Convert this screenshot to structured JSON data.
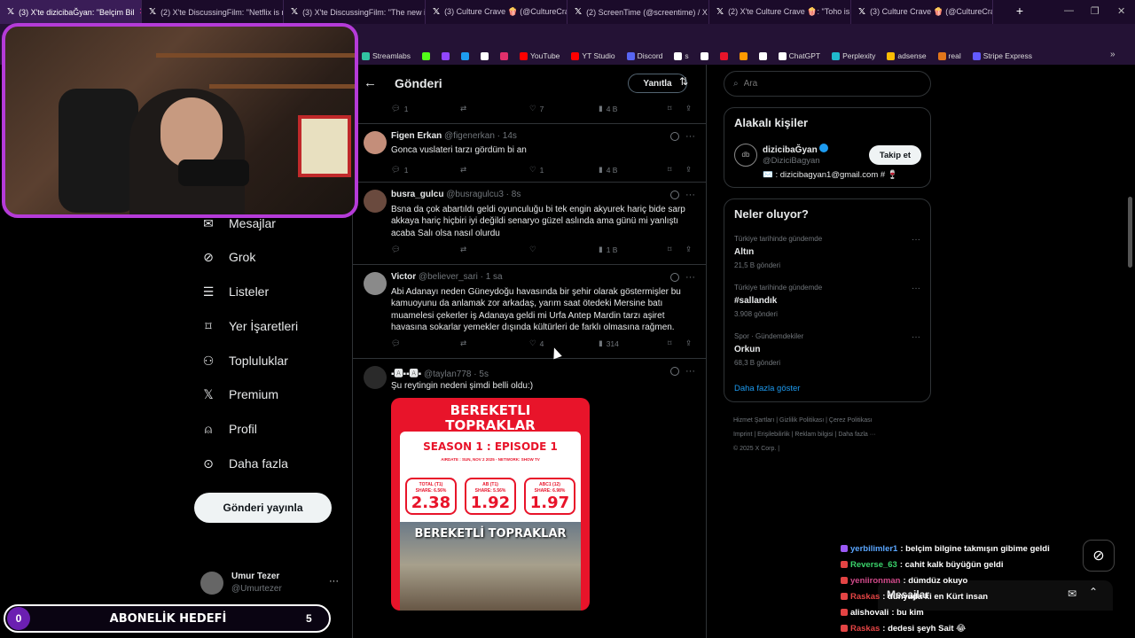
{
  "browser": {
    "tabs": [
      {
        "label": "(3) X'te dizicibaĞyan: \"Belçim Bil",
        "active": true
      },
      {
        "label": "(2) X'te DiscussingFilm: \"Netflix is no",
        "active": false
      },
      {
        "label": "(3) X'te DiscussingFilm: \"The new ini",
        "active": false
      },
      {
        "label": "(3) Culture Crave 🍿 (@CultureCrav",
        "active": false
      },
      {
        "label": "(2) ScreenTime (@screentime) / X",
        "active": false
      },
      {
        "label": "(2) X'te Culture Crave 🍿: \"Toho is m",
        "active": false
      },
      {
        "label": "(3) Culture Crave 🍿 (@CultureCrav",
        "active": false
      }
    ],
    "bookmarks": [
      {
        "label": "Streamlabs",
        "color": "#31c3a2"
      },
      {
        "label": "",
        "color": "#53fc18"
      },
      {
        "label": "",
        "color": "#9146ff"
      },
      {
        "label": "",
        "color": "#1d9bf0"
      },
      {
        "label": "",
        "color": "#ffffff"
      },
      {
        "label": "",
        "color": "#e1306c"
      },
      {
        "label": "YouTube",
        "color": "#ff0000"
      },
      {
        "label": "YT Studio",
        "color": "#ff0000"
      },
      {
        "label": "Discord",
        "color": "#5865f2"
      },
      {
        "label": "s",
        "color": "#ffffff"
      },
      {
        "label": "",
        "color": "#ffffff"
      },
      {
        "label": "",
        "color": "#e8142a"
      },
      {
        "label": "",
        "color": "#ff9900"
      },
      {
        "label": "",
        "color": "#ffffff"
      },
      {
        "label": "ChatGPT",
        "color": "#ffffff"
      },
      {
        "label": "Perplexity",
        "color": "#20b8cd"
      },
      {
        "label": "adsense",
        "color": "#fbbc04"
      },
      {
        "label": "real",
        "color": "#e2761b"
      },
      {
        "label": "Stripe Express",
        "color": "#635bff"
      }
    ]
  },
  "nav": {
    "items": [
      {
        "label": "Mesajlar",
        "icon": "mail-icon"
      },
      {
        "label": "Grok",
        "icon": "grok-icon"
      },
      {
        "label": "Listeler",
        "icon": "list-icon"
      },
      {
        "label": "Yer İşaretleri",
        "icon": "bookmark-icon"
      },
      {
        "label": "Topluluklar",
        "icon": "communities-icon"
      },
      {
        "label": "Premium",
        "icon": "x-logo-icon"
      },
      {
        "label": "Profil",
        "icon": "profile-icon"
      },
      {
        "label": "Daha fazla",
        "icon": "more-circle-icon"
      }
    ],
    "post_button": "Gönderi yayınla",
    "account": {
      "name": "Umur Tezer",
      "handle": "@Umurtezer"
    }
  },
  "overlay": {
    "sub_goal": {
      "label": "ABONELİK HEDEFİ",
      "current": "0",
      "target": "5"
    }
  },
  "feed": {
    "title": "Gönderi",
    "reply_button": "Yanıtla",
    "top_actions": {
      "replies": "1",
      "retweets": "",
      "likes": "7",
      "views": "4 B"
    },
    "tweets": [
      {
        "name": "Figen Erkan",
        "handle": "@figenerkan",
        "time": "14s",
        "text": "Gonca vuslateri  tarzı gördüm bi an",
        "replies": "1",
        "retweets": "",
        "likes": "1",
        "views": "4 B"
      },
      {
        "name": "busra_gulcu",
        "handle": "@busragulcu3",
        "time": "8s",
        "text": "Bsna da çok abartıldı geldi oyunculuğu bi tek engin akyurek hariç bide sarp akkaya hariç hiçbiri iyi değildi senaryo güzel aslında ama günü mi yanlıştı acaba Salı olsa nasıl olurdu",
        "replies": "",
        "retweets": "",
        "likes": "",
        "views": "1 B"
      },
      {
        "name": "Victor",
        "handle": "@believer_sari",
        "time": "1 sa",
        "text": "Abi Adanayı neden Güneydoğu havasında bir şehir olarak göstermişler bu kamuoyunu da anlamak zor arkadaş, yarım saat ötedeki Mersine batı muamelesi çekerler iş Adanaya geldi mi Urfa Antep Mardin tarzı aşiret havasına sokarlar yemekler dışında kültürleri de farklı olmasına rağmen.",
        "replies": "",
        "retweets": "",
        "likes": "4",
        "views": "314"
      },
      {
        "name": "▪🅰▪▪🅰▪",
        "handle": "@taylan778",
        "time": "5s",
        "text": "Şu reytingin nedeni şimdi belli oldu:)",
        "replies": "",
        "retweets": "",
        "likes": "",
        "views": ""
      }
    ],
    "poster": {
      "title_line1": "BEREKETLI",
      "title_line2": "TOPRAKLAR",
      "episode": "SEASON 1 : EPISODE 1",
      "airdate": "AIRDATE : SUN, NOV 2 2025 - NETWORK: SHOW TV",
      "ratings": [
        {
          "label": "TOTAL (T1)",
          "share": "SHARE: 6.56%",
          "value": "2.38"
        },
        {
          "label": "AB (T1)",
          "share": "SHARE: 5.56%",
          "value": "1.92"
        },
        {
          "label": "ABC1 (12)",
          "share": "SHARE: 6.98%",
          "value": "1.97"
        }
      ],
      "banner": "BEREKETLİ TOPRAKLAR"
    }
  },
  "right": {
    "search_placeholder": "Ara",
    "related": {
      "title": "Alakalı kişiler",
      "name": "dizicibaĞyan",
      "handle": "@DiziciBagyan",
      "bio": "✉️ : dizicibagyan1@gmail.com # 🍷",
      "follow_label": "Takip et"
    },
    "trends": {
      "title": "Neler oluyor?",
      "items": [
        {
          "context": "Türkiye tarihinde gündemde",
          "name": "Altın",
          "count": "21,5 B gönderi"
        },
        {
          "context": "Türkiye tarihinde gündemde",
          "name": "#sallandık",
          "count": "3.908 gönderi"
        },
        {
          "context": "Spor · Gündemdekiler",
          "name": "Orkun",
          "count": "68,3 B gönderi"
        }
      ],
      "show_more": "Daha fazla göster"
    },
    "footer": [
      "Hizmet Şartları",
      "Gizlilik Politikası",
      "Çerez Politikası",
      "Imprint",
      "Erişilebilirlik",
      "Reklam bilgisi",
      "Daha fazla ···",
      "© 2025 X Corp."
    ]
  },
  "chat": {
    "messages": [
      {
        "user": "yerbilimler1",
        "text": ": belçim bilgine takmışın gibime geldi",
        "color": "#5aa6ff"
      },
      {
        "user": "Reverse_63",
        "text": ": cahit kalk büyüğün geldi",
        "color": "#3ad36b"
      },
      {
        "user": "yeniironman",
        "text": ": dümdüz okuyo",
        "color": "#d14a8a"
      },
      {
        "user": "Raskas",
        "text": ": dünyada ki en Kürt insan",
        "color": "#e34444"
      },
      {
        "user": "alishovali",
        "text": ": bu kim",
        "color": "#ffffff"
      },
      {
        "user": "Raskas",
        "text": ": dedesi şeyh Sait 😂",
        "color": "#e34444"
      }
    ],
    "drawer_label": "Mesajlar"
  }
}
